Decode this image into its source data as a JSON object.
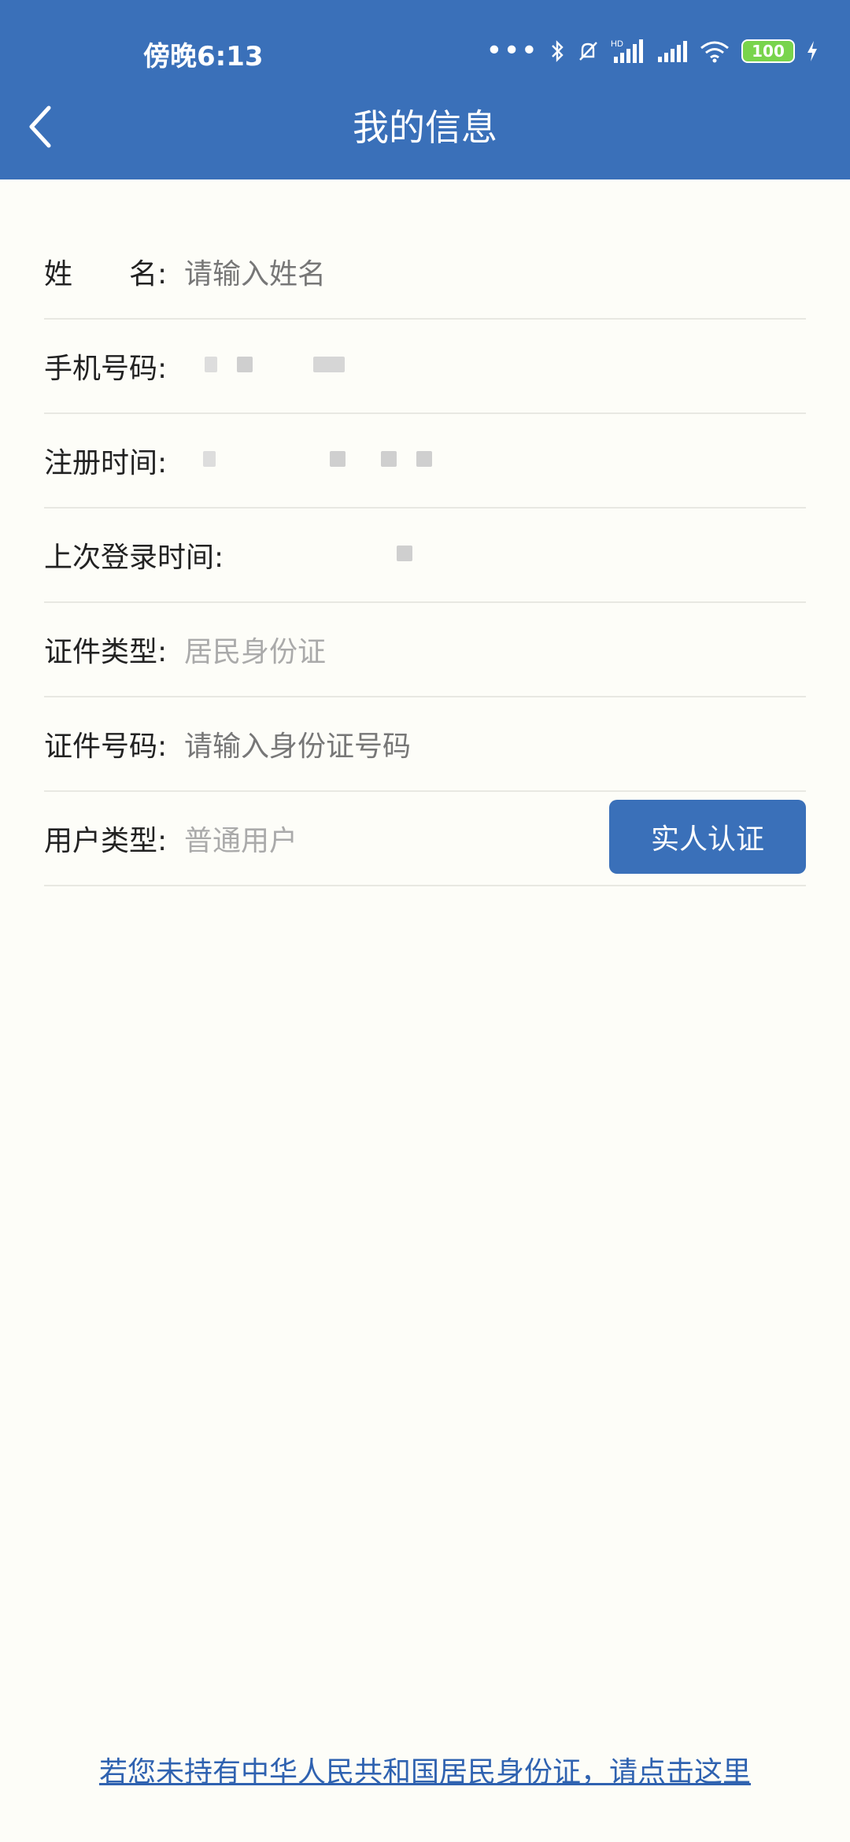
{
  "status_bar": {
    "time": "傍晚6:13",
    "network_hd": "HD",
    "battery": "100",
    "icons": [
      "more-dots-icon",
      "bluetooth-icon",
      "mute-bell-icon",
      "signal-hd-icon",
      "signal-icon",
      "wifi-icon",
      "battery-icon",
      "charging-icon"
    ]
  },
  "header": {
    "title": "我的信息",
    "back_icon": "chevron-left-icon"
  },
  "form": {
    "name": {
      "label": "姓　　名:",
      "placeholder": "请输入姓名"
    },
    "phone": {
      "label": "手机号码:"
    },
    "register_time": {
      "label": "注册时间:"
    },
    "last_login": {
      "label": "上次登录时间:"
    },
    "id_type": {
      "label": "证件类型:",
      "value": "居民身份证"
    },
    "id_number": {
      "label": "证件号码:",
      "placeholder": "请输入身份证号码"
    },
    "user_type": {
      "label": "用户类型:",
      "value": "普通用户",
      "button": "实人认证"
    }
  },
  "footer": {
    "link": "若您未持有中华人民共和国居民身份证，请点击这里"
  },
  "colors": {
    "primary": "#3a70b9",
    "background": "#fdfdf8",
    "link": "#2f62b0"
  }
}
